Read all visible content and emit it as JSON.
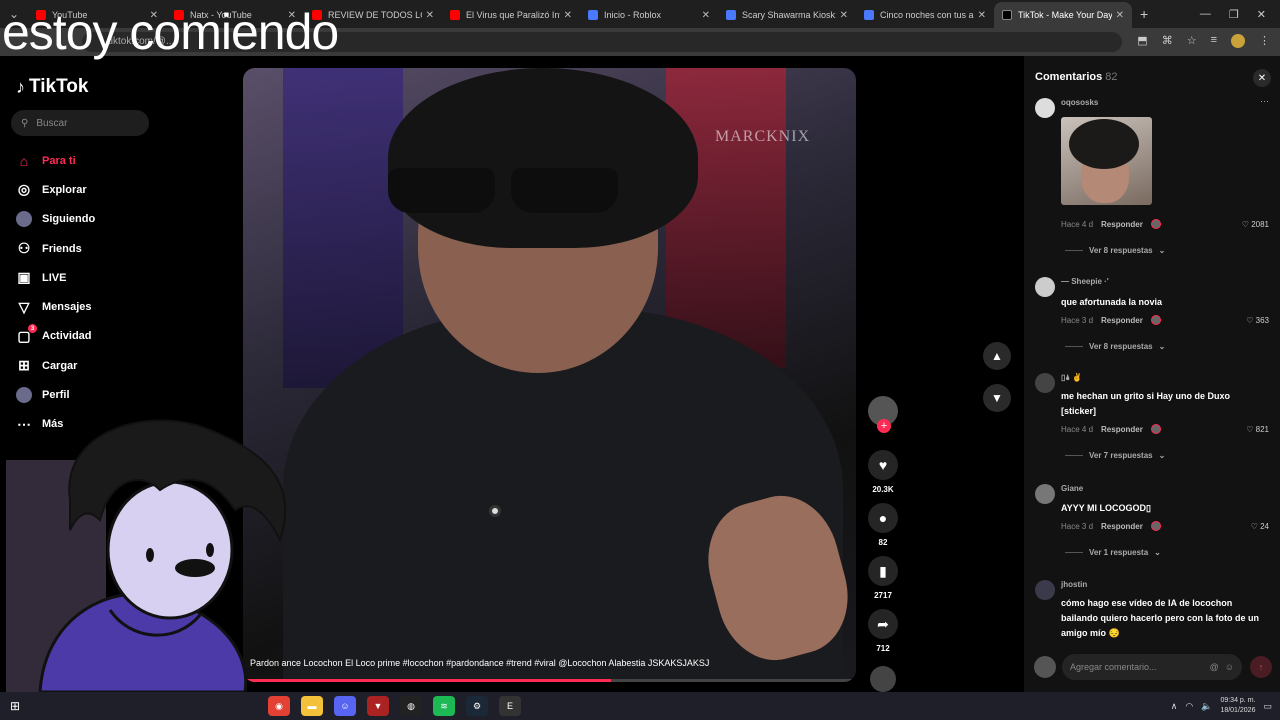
{
  "overlay_text": "estoy comiendo",
  "browser": {
    "tabs": [
      {
        "label": "YouTube",
        "favicon": "youtube-icon",
        "active": false
      },
      {
        "label": "Natx - YouTube",
        "favicon": "youtube-icon",
        "active": false
      },
      {
        "label": "REVIEW DE TODOS LOS N",
        "favicon": "youtube-icon",
        "active": false
      },
      {
        "label": "El Virus que Paralizó Inter",
        "favicon": "youtube-icon",
        "active": false
      },
      {
        "label": "Inicio - Roblox",
        "favicon": "roblox-icon",
        "active": false
      },
      {
        "label": "Scary Shawarma Kiosk: th",
        "favicon": "roblox-icon",
        "active": false
      },
      {
        "label": "Cinco noches con tus am",
        "favicon": "roblox-icon",
        "active": false
      },
      {
        "label": "TikTok - Make Your Day",
        "favicon": "tiktok-icon",
        "active": true
      }
    ],
    "url": "tiktok.com/@..."
  },
  "sidebar": {
    "logo": "TikTok",
    "search_placeholder": "Buscar",
    "items": [
      {
        "label": "Para ti",
        "icon": "home-icon",
        "active": true
      },
      {
        "label": "Explorar",
        "icon": "compass-icon"
      },
      {
        "label": "Siguiendo",
        "icon": "following-avatar"
      },
      {
        "label": "Friends",
        "icon": "friends-icon"
      },
      {
        "label": "LIVE",
        "icon": "live-icon"
      },
      {
        "label": "Mensajes",
        "icon": "messages-icon"
      },
      {
        "label": "Actividad",
        "icon": "activity-icon",
        "badge": "3"
      },
      {
        "label": "Cargar",
        "icon": "upload-icon"
      },
      {
        "label": "Perfil",
        "icon": "profile-avatar"
      },
      {
        "label": "Más",
        "icon": "more-icon"
      }
    ]
  },
  "video": {
    "watermark": "MARCKNIX",
    "caption": "Pardon ance Locochon El Loco prime #locochon #pardondance #trend #viral @Locochon Alabestia JSKAKSJAKSJ",
    "progress_fraction": 0.6
  },
  "actions": {
    "likes": "20.3K",
    "comments": "82",
    "saves": "2717",
    "shares": "712"
  },
  "comments_panel": {
    "title": "Comentarios",
    "count": "82",
    "items": [
      {
        "user": "oqososks",
        "text": "",
        "has_image": true,
        "time": "Hace 4 d",
        "reply": "Responder",
        "likes": "2081",
        "replies": "Ver 8 respuestas"
      },
      {
        "user": "— Sheepie ·'",
        "text": "que afortunada la novia",
        "time": "Hace 3 d",
        "reply": "Responder",
        "likes": "363",
        "replies": "Ver 8 respuestas"
      },
      {
        "user": "▯🌢 ✌",
        "text": "me hechan un grito si Hay uno de Duxo [sticker]",
        "time": "Hace 4 d",
        "reply": "Responder",
        "likes": "821",
        "replies": "Ver 7 respuestas"
      },
      {
        "user": "Giane",
        "text": "AYYY MI LOCOGOD▯",
        "time": "Hace 3 d",
        "reply": "Responder",
        "likes": "24",
        "replies": "Ver 1 respuesta"
      },
      {
        "user": "jhostin",
        "text": "cómo hago ese vídeo de IA de locochon bailando quiero hacerlo pero con la foto de un amigo mío 😔"
      }
    ],
    "input_placeholder": "Agregar comentario..."
  },
  "taskbar": {
    "time": "09:34 p. m.",
    "date": "18/01/2026"
  },
  "colors": {
    "accent": "#fe2c55",
    "background": "#000000",
    "panel": "#121212"
  }
}
